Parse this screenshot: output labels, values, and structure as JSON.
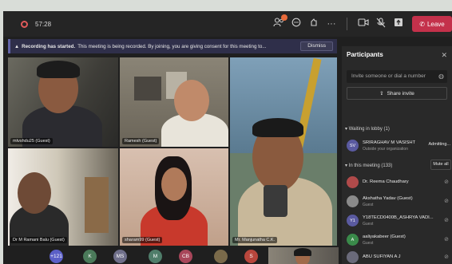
{
  "topbar": {
    "timer": "57:28",
    "icons": [
      "participants-icon",
      "chat-icon",
      "reactions-icon",
      "more-icon",
      "camera-icon",
      "mic-off-icon",
      "share-icon"
    ],
    "participants_badge": "",
    "leave_label": "Leave"
  },
  "banner": {
    "title": "Recording has started.",
    "text": "This meeting is being recorded. By joining, you are giving consent for this meeting to...",
    "dismiss": "Dismiss"
  },
  "tiles": [
    {
      "label": "mtvshdu25 (Guest)"
    },
    {
      "label": "Ramesh (Guest)"
    },
    {
      "label": "Mr. Manjunatha C.K."
    },
    {
      "label": "Dr M Ramani Balu (Guest)"
    },
    {
      "label": "sharam99 (Guest)"
    }
  ],
  "bottom_avatars": [
    {
      "text": "+121",
      "color": "#5b5fc7"
    },
    {
      "text": "K",
      "color": "#4b7a5a"
    },
    {
      "text": "MS",
      "color": "#6f6f8a"
    },
    {
      "text": "M",
      "color": "#4f7d6a"
    },
    {
      "text": "CB",
      "color": "#a8465a"
    },
    {
      "text": "",
      "color": "#7a6a4a"
    },
    {
      "text": "S",
      "color": "#b8463c"
    }
  ],
  "panel": {
    "title": "Participants",
    "invite_placeholder": "Invite someone or dial a number",
    "share_invite": "Share invite",
    "lobby_header": "Waiting in lobby (1)",
    "lobby": [
      {
        "initials": "SV",
        "name": "SRIRAGHAV M VASISHT",
        "sub": "Outside your organization",
        "action": "Admitting...",
        "color": "#5a5aa0"
      }
    ],
    "meeting_header": "In this meeting (133)",
    "mute_all": "Mute all",
    "members": [
      {
        "initials": "",
        "name": "Dr. Reema Chaudhary",
        "sub": "",
        "color": "#b04a4a"
      },
      {
        "initials": "",
        "name": "Akshatha Yadav (Guest)",
        "sub": "Guest",
        "color": "#8a8a8a"
      },
      {
        "initials": "Y1",
        "name": "Y18TECD0400B_ASHRYA VADI...",
        "sub": "Guest",
        "color": "#5a5aa0"
      },
      {
        "initials": "A",
        "name": "aaliyakabeer (Guest)",
        "sub": "Guest",
        "color": "#3a8a4a"
      },
      {
        "initials": "",
        "name": "ABU SUFIYAN A J",
        "sub": "",
        "color": "#6a6a7a"
      }
    ]
  }
}
